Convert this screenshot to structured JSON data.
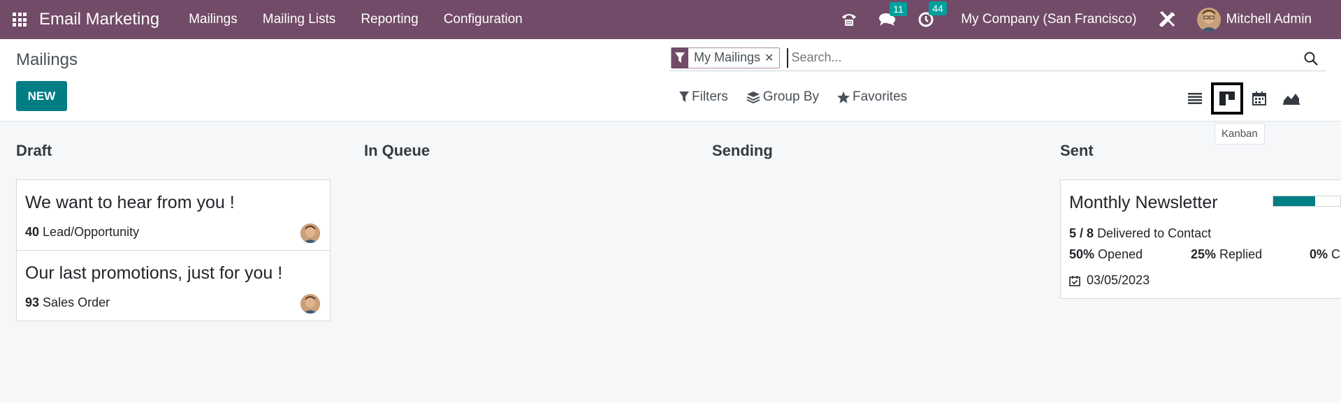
{
  "app": {
    "title": "Email Marketing"
  },
  "menu": [
    "Mailings",
    "Mailing Lists",
    "Reporting",
    "Configuration"
  ],
  "systray": {
    "messages_count": "11",
    "activities_count": "44",
    "company": "My Company (San Francisco)",
    "user": "Mitchell Admin"
  },
  "breadcrumb": "Mailings",
  "new_label": "NEW",
  "search": {
    "facet": "My Mailings",
    "placeholder": "Search..."
  },
  "filters": {
    "filters": "Filters",
    "group_by": "Group By",
    "favorites": "Favorites"
  },
  "tooltip": "Kanban",
  "columns": [
    "Draft",
    "In Queue",
    "Sending",
    "Sent"
  ],
  "draft_cards": [
    {
      "title": "We want to hear from you !",
      "count": "40",
      "model": "Lead/Opportunity"
    },
    {
      "title": "Our last promotions, just for you !",
      "count": "93",
      "model": "Sales Order"
    }
  ],
  "sent_card": {
    "title": "Monthly Newsletter",
    "progress_fraction": 0.625,
    "delivered_num": "5",
    "delivered_sep": " / ",
    "delivered_den": "8",
    "delivered_label": "Delivered to Contact",
    "opened_value": "50%",
    "opened_label": "Opened",
    "replied_value": "25%",
    "replied_label": "Replied",
    "clicked_value": "0%",
    "clicked_label": "C",
    "date": "03/05/2023"
  },
  "colors": {
    "brand": "#714b67",
    "accent": "#017e84",
    "badge": "#00a09d"
  }
}
